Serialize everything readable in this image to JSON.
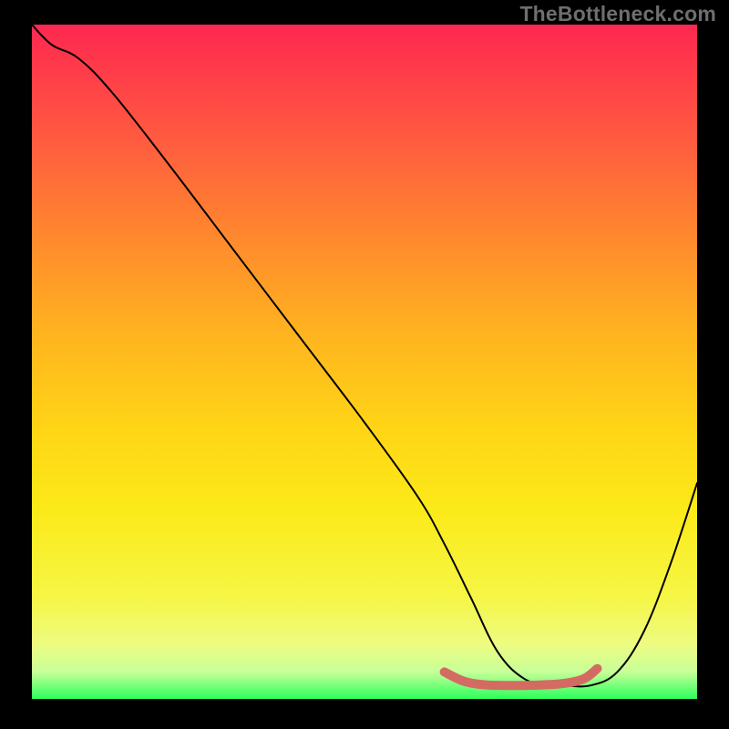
{
  "watermark": "TheBottleneck.com",
  "chart_data": {
    "type": "line",
    "title": "",
    "xlabel": "",
    "ylabel": "",
    "xlim": [
      0,
      100
    ],
    "ylim": [
      0,
      100
    ],
    "gradient_background": {
      "top_color": "#fe2850",
      "bottom_color": "#2bff5b",
      "description": "vertical red-to-green gradient"
    },
    "series": [
      {
        "name": "thin-black-curve",
        "color": "#000000",
        "stroke_width": 2,
        "x": [
          0,
          3,
          7,
          12,
          20,
          30,
          40,
          50,
          58,
          62,
          66,
          70,
          74,
          78,
          80,
          84,
          88,
          92,
          96,
          100
        ],
        "y": [
          100,
          97,
          95,
          90,
          80,
          67,
          54,
          41,
          30,
          23,
          15,
          7,
          3,
          2,
          2,
          2,
          4,
          10,
          20,
          32
        ]
      },
      {
        "name": "thick-red-valley",
        "color": "#d46b63",
        "stroke_width": 10,
        "x": [
          62,
          65,
          68,
          71,
          74,
          77,
          80,
          83,
          85
        ],
        "y": [
          4,
          2.6,
          2.1,
          2.0,
          2.0,
          2.1,
          2.3,
          3.0,
          4.5
        ]
      }
    ]
  }
}
